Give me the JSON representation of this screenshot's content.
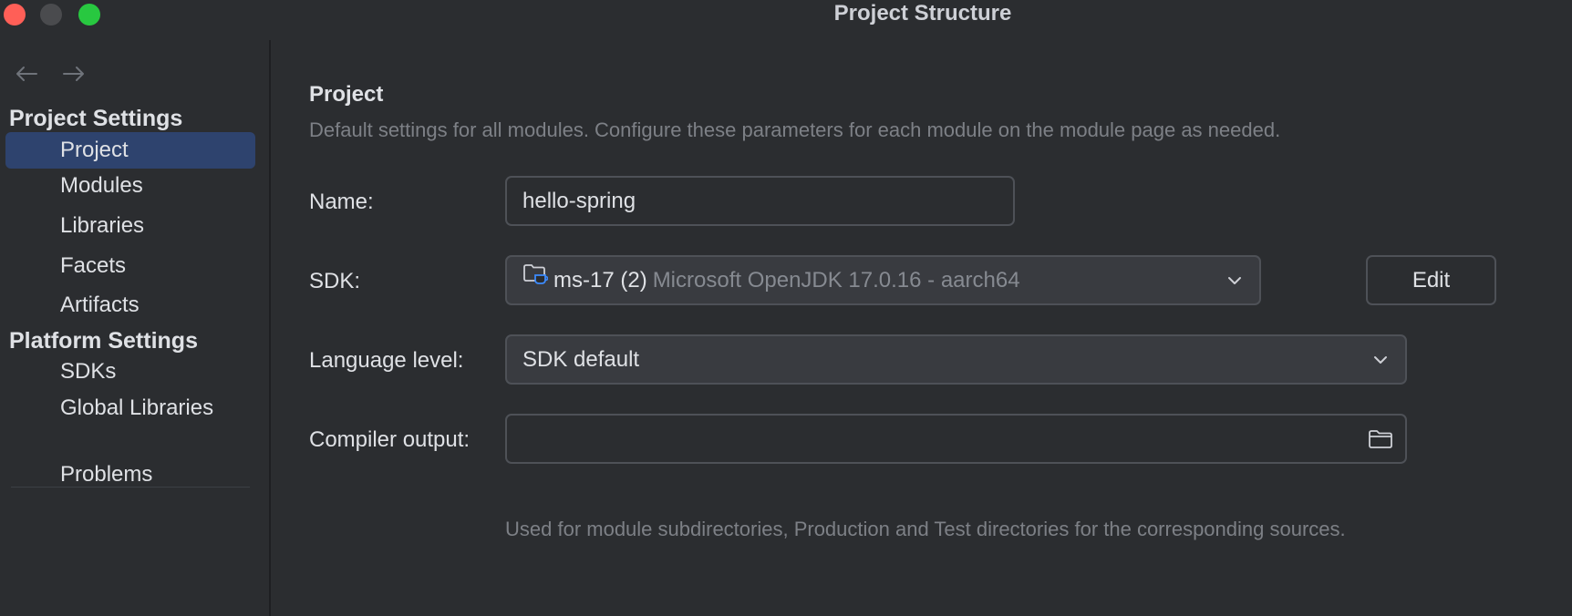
{
  "window": {
    "title": "Project Structure"
  },
  "sidebar": {
    "project_settings_header": "Project Settings",
    "platform_settings_header": "Platform Settings",
    "project_items": [
      {
        "label": "Project",
        "selected": true
      },
      {
        "label": "Modules",
        "selected": false
      },
      {
        "label": "Libraries",
        "selected": false
      },
      {
        "label": "Facets",
        "selected": false
      },
      {
        "label": "Artifacts",
        "selected": false
      }
    ],
    "platform_items": [
      {
        "label": "SDKs",
        "selected": false
      },
      {
        "label": "Global Libraries",
        "selected": false
      }
    ],
    "problems_label": "Problems",
    "back_icon": "arrow-left-icon",
    "forward_icon": "arrow-right-icon"
  },
  "main": {
    "heading": "Project",
    "description": "Default settings for all modules. Configure these parameters for each module on the module page as needed.",
    "name": {
      "label": "Name:",
      "value": "hello-spring"
    },
    "sdk": {
      "label": "SDK:",
      "selected_name": "ms-17 (2)",
      "selected_detail": "Microsoft OpenJDK 17.0.16 - aarch64",
      "icon": "jdk-folder-icon",
      "edit_label": "Edit"
    },
    "language_level": {
      "label": "Language level:",
      "selected": "SDK default"
    },
    "compiler_output": {
      "label": "Compiler output:",
      "value": "",
      "hint": "Used for module subdirectories, Production and Test directories for the corresponding sources."
    }
  },
  "colors": {
    "background": "#2b2d30",
    "selection": "#2e436e",
    "border": "#4e5157",
    "muted_text": "#7d8086",
    "close": "#ff5f57",
    "maximize": "#28c840"
  }
}
